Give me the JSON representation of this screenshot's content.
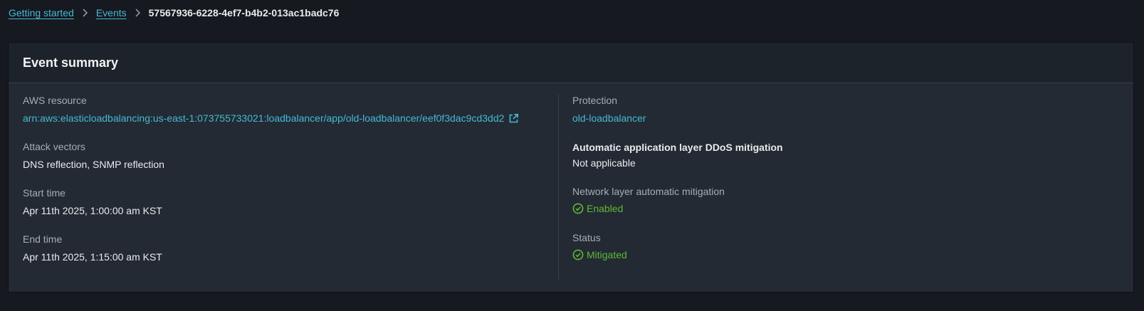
{
  "breadcrumb": {
    "items": [
      {
        "label": "Getting started"
      },
      {
        "label": "Events"
      }
    ],
    "current": "57567936-6228-4ef7-b4b2-013ac1badc76"
  },
  "summary": {
    "title": "Event summary",
    "left": {
      "aws_resource": {
        "label": "AWS resource",
        "value": "arn:aws:elasticloadbalancing:us-east-1:073755733021:loadbalancer/app/old-loadbalancer/eef0f3dac9cd3dd2",
        "icon": "external-link-icon"
      },
      "attack_vectors": {
        "label": "Attack vectors",
        "value": "DNS reflection, SNMP reflection"
      },
      "start_time": {
        "label": "Start time",
        "value": "Apr 11th 2025, 1:00:00 am KST"
      },
      "end_time": {
        "label": "End time",
        "value": "Apr 11th 2025, 1:15:00 am KST"
      }
    },
    "right": {
      "protection": {
        "label": "Protection",
        "value": "old-loadbalancer"
      },
      "app_ddos": {
        "label": "Automatic application layer DDoS mitigation",
        "value": "Not applicable"
      },
      "network_mitigation": {
        "label": "Network layer automatic mitigation",
        "value": "Enabled",
        "icon": "check-circle-icon"
      },
      "status": {
        "label": "Status",
        "value": "Mitigated",
        "icon": "check-circle-icon"
      }
    }
  },
  "colors": {
    "link": "#44b9d6",
    "success": "#5fb83a",
    "background": "#16191f",
    "panel": "#232a33"
  }
}
